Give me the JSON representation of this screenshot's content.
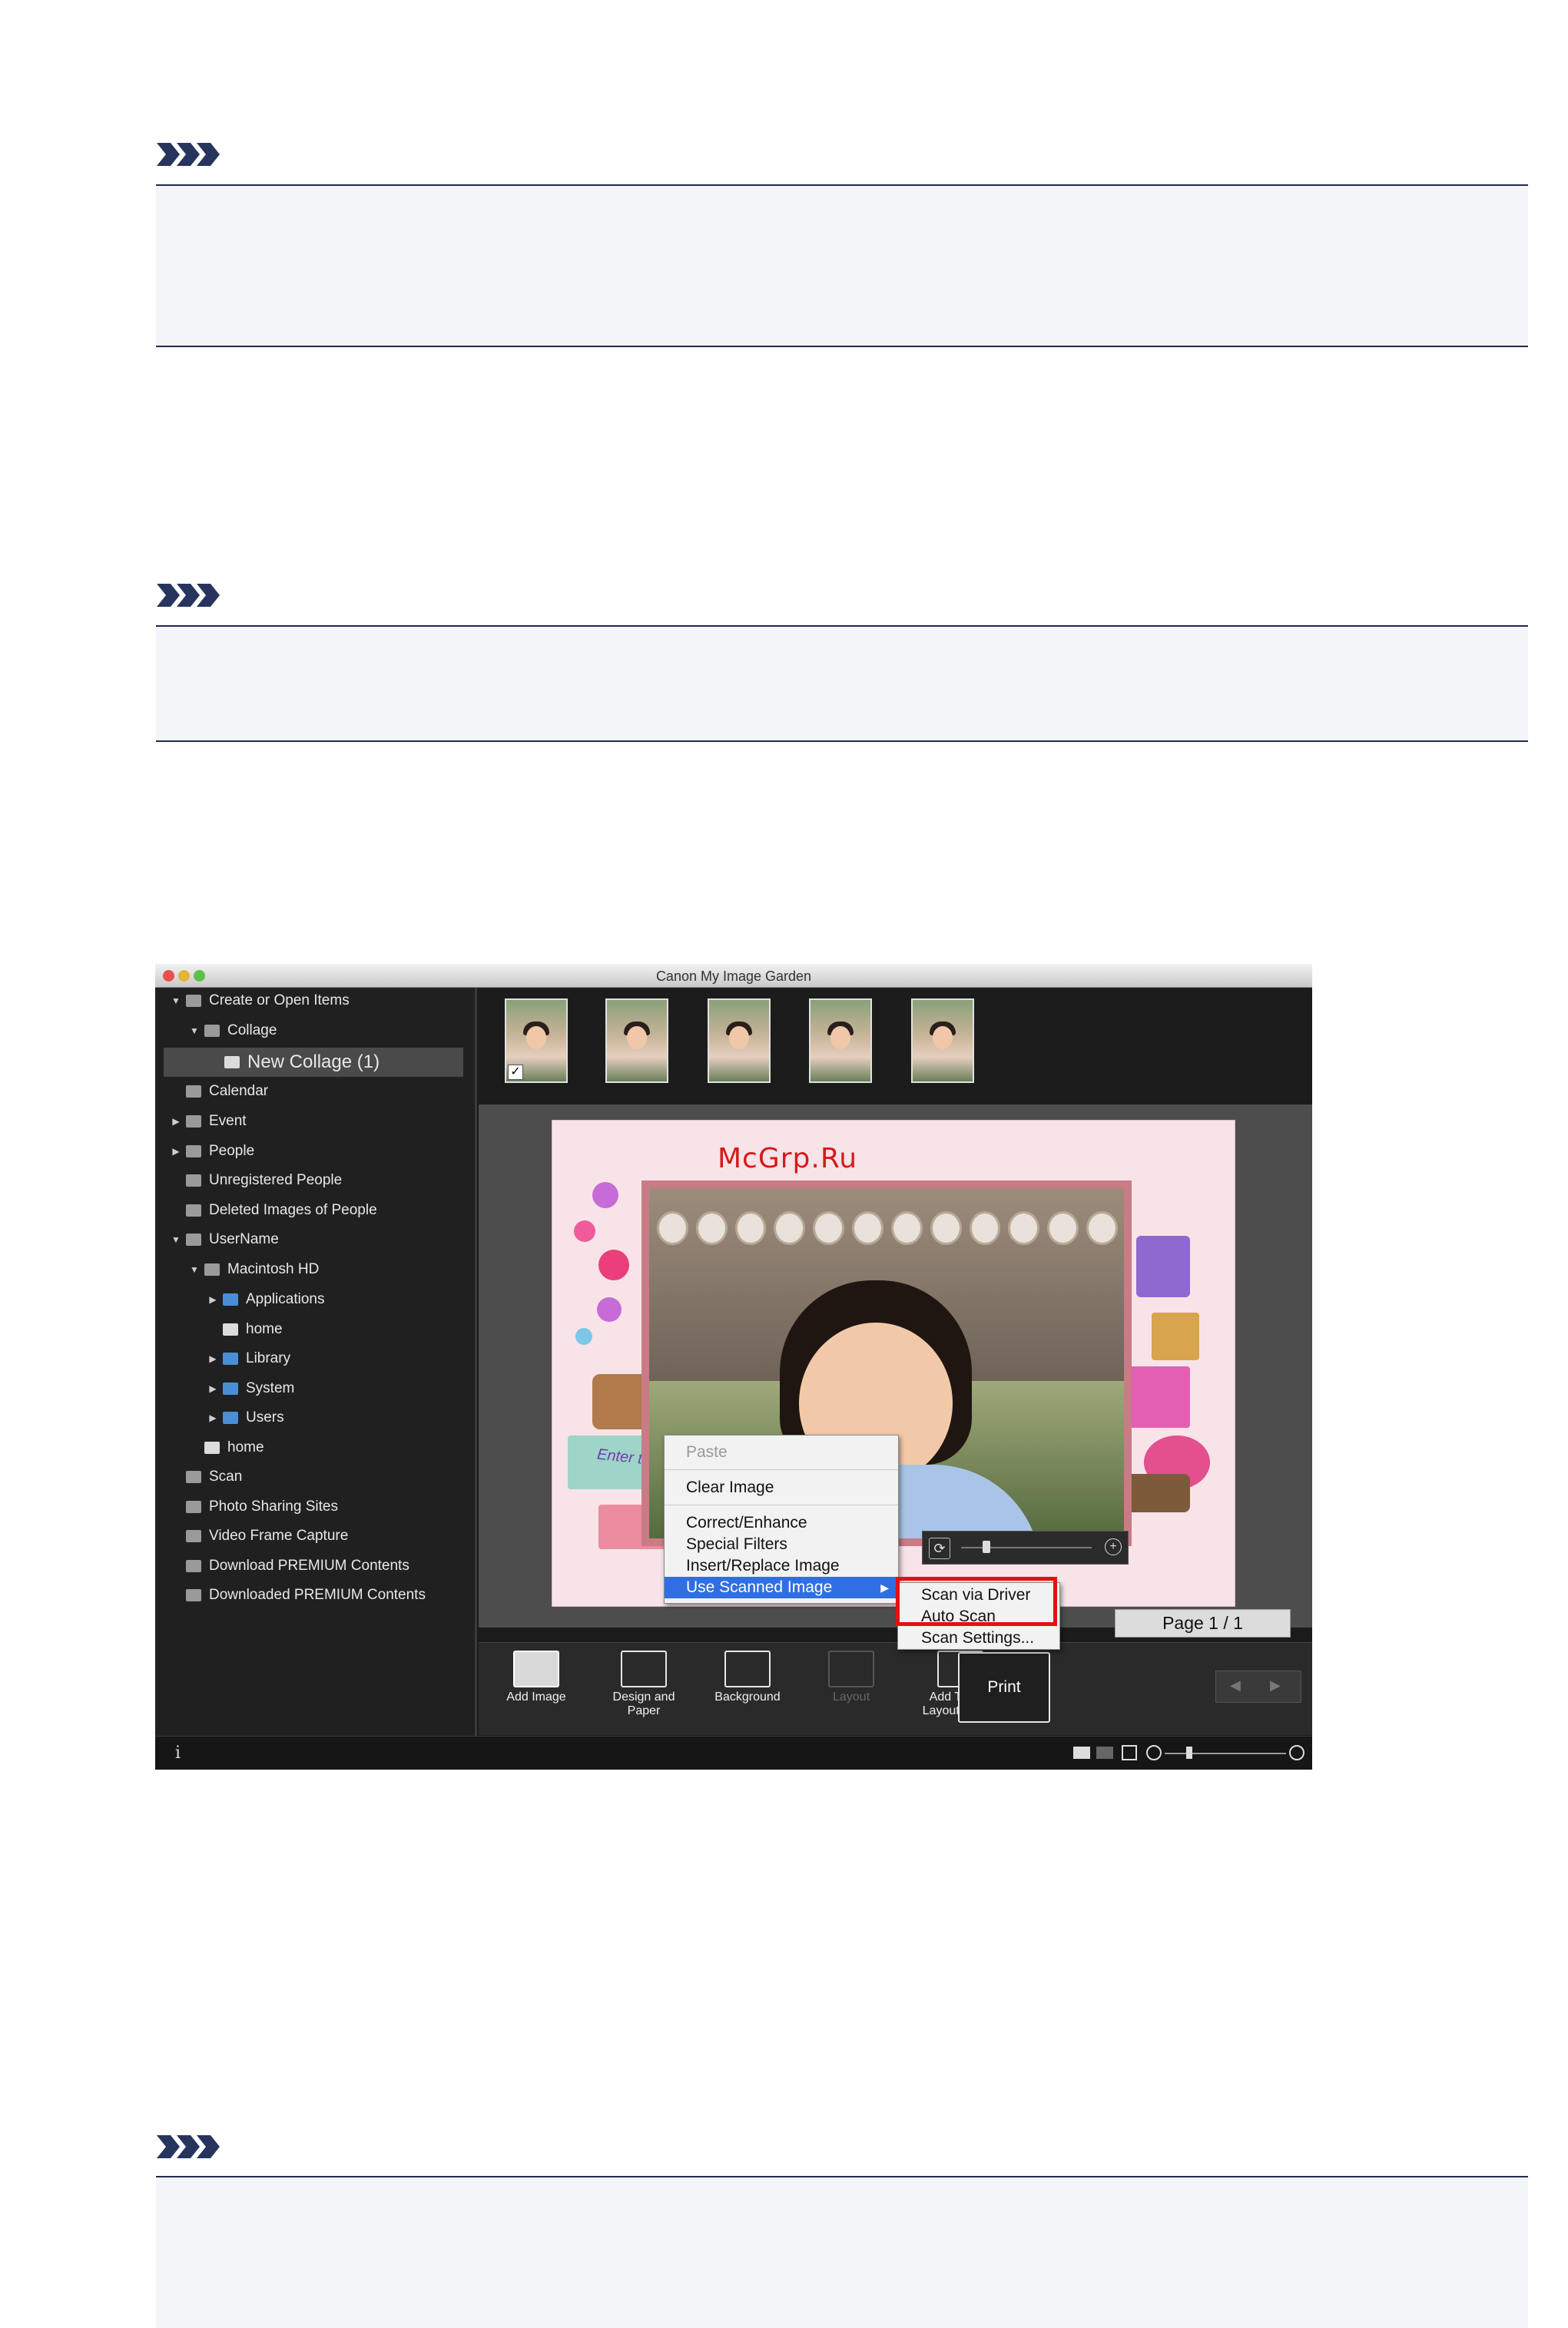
{
  "app": {
    "window_title": "Canon My Image Garden",
    "watermark": "McGrp.Ru"
  },
  "sidebar": {
    "items": [
      {
        "label": "Create or Open Items",
        "level": 0,
        "arrow": "down",
        "icon": "create-items-icon"
      },
      {
        "label": "Collage",
        "level": 1,
        "arrow": "down",
        "icon": "collage-icon"
      },
      {
        "label": "New Collage (1)",
        "level": 2,
        "arrow": "",
        "icon": "collage-item-icon",
        "selected": true
      },
      {
        "label": "Calendar",
        "level": 0,
        "arrow": "",
        "icon": "calendar-icon"
      },
      {
        "label": "Event",
        "level": 0,
        "arrow": "right",
        "icon": "event-icon"
      },
      {
        "label": "People",
        "level": 0,
        "arrow": "right",
        "icon": "people-icon"
      },
      {
        "label": "Unregistered People",
        "level": 0,
        "arrow": "",
        "icon": "person-icon"
      },
      {
        "label": "Deleted Images of People",
        "level": 0,
        "arrow": "",
        "icon": "person-outline-icon"
      },
      {
        "label": "UserName",
        "level": 0,
        "arrow": "down",
        "icon": "computer-icon"
      },
      {
        "label": "Macintosh HD",
        "level": 1,
        "arrow": "down",
        "icon": "hard-drive-icon"
      },
      {
        "label": "Applications",
        "level": 2,
        "arrow": "right",
        "icon": "folder-icon"
      },
      {
        "label": "home",
        "level": 2,
        "arrow": "",
        "icon": "drive-icon"
      },
      {
        "label": "Library",
        "level": 2,
        "arrow": "right",
        "icon": "folder-icon"
      },
      {
        "label": "System",
        "level": 2,
        "arrow": "right",
        "icon": "folder-icon"
      },
      {
        "label": "Users",
        "level": 2,
        "arrow": "right",
        "icon": "folder-icon"
      },
      {
        "label": "home",
        "level": 1,
        "arrow": "",
        "icon": "drive-icon"
      },
      {
        "label": "Scan",
        "level": 0,
        "arrow": "",
        "icon": "scan-icon"
      },
      {
        "label": "Photo Sharing Sites",
        "level": 0,
        "arrow": "",
        "icon": "photo-sharing-icon"
      },
      {
        "label": "Video Frame Capture",
        "level": 0,
        "arrow": "",
        "icon": "video-frame-icon"
      },
      {
        "label": "Download PREMIUM Contents",
        "level": 0,
        "arrow": "",
        "icon": "download-icon"
      },
      {
        "label": "Downloaded PREMIUM Contents",
        "level": 0,
        "arrow": "",
        "icon": "downloaded-icon"
      }
    ]
  },
  "canvas": {
    "text_placeholder": "Enter text",
    "page_indicator": "Page 1 / 1"
  },
  "context_menu": {
    "paste": "Paste",
    "clear_image": "Clear Image",
    "correct_enhance": "Correct/Enhance",
    "special_filters": "Special Filters",
    "insert_replace": "Insert/Replace Image",
    "use_scanned": "Use Scanned Image",
    "submenu_arrow": "▶"
  },
  "submenu": {
    "scan_via_driver": "Scan via Driver",
    "auto_scan": "Auto Scan",
    "scan_settings": "Scan Settings..."
  },
  "toolbar": {
    "add_image": "Add Image",
    "design_paper": "Design and Paper",
    "background": "Background",
    "layout": "Layout",
    "add_text": "Add Text or Layout Frame",
    "print": "Print",
    "more_arrow": "▶"
  },
  "statusbar": {
    "info": "i"
  },
  "colors": {
    "highlight": "#2f6fe3",
    "callout": "#e11212",
    "note_rule": "#1f2a4e"
  }
}
